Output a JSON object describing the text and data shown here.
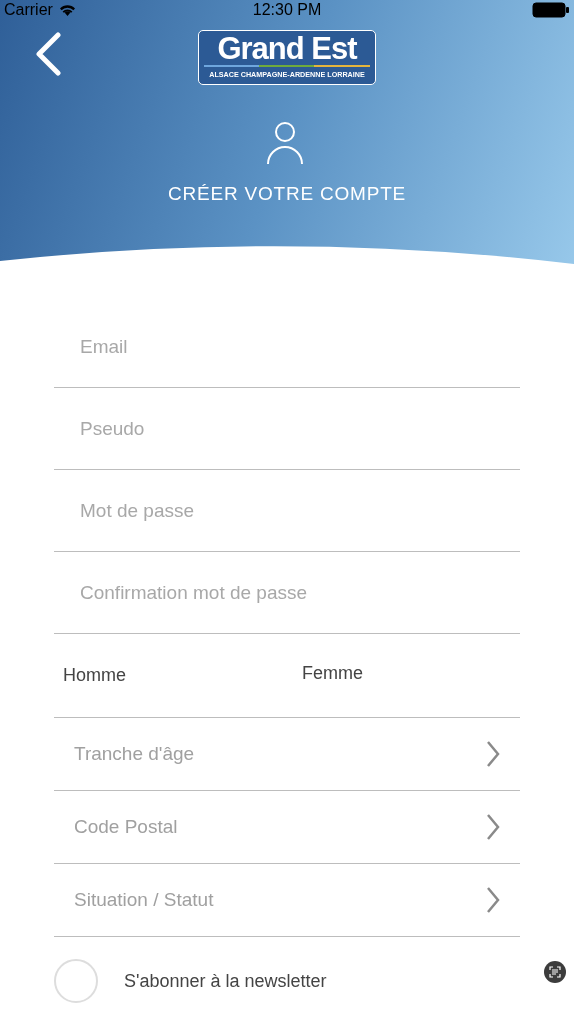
{
  "status_bar": {
    "carrier": "Carrier",
    "time": "12:30 PM"
  },
  "header": {
    "logo_title": "Grand Est",
    "logo_subtitle": "ALSACE CHAMPAGNE-ARDENNE LORRAINE",
    "title": "CRÉER VOTRE COMPTE"
  },
  "fields": [
    {
      "placeholder": "Email"
    },
    {
      "placeholder": "Pseudo"
    },
    {
      "placeholder": "Mot de passe"
    },
    {
      "placeholder": "Confirmation mot de passe"
    }
  ],
  "gender": [
    {
      "label": "Homme",
      "selected": false
    },
    {
      "label": "Femme",
      "selected": false
    }
  ],
  "selects": [
    {
      "label": "Tranche d'âge"
    },
    {
      "label": "Code Postal"
    },
    {
      "label": "Situation / Statut"
    }
  ],
  "newsletter": {
    "label": "S'abonner à la newsletter",
    "checked": false
  }
}
